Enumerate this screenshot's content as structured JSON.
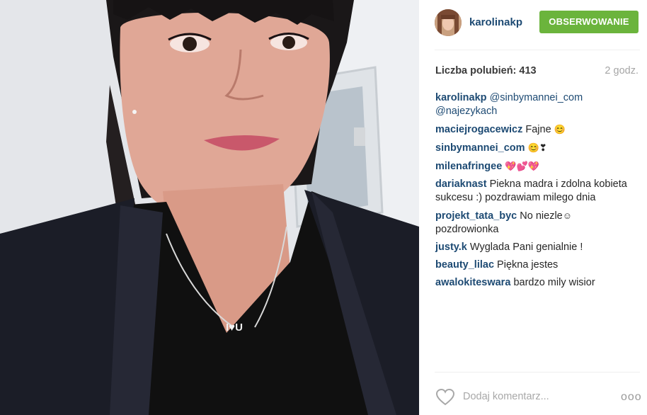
{
  "post": {
    "username": "karolinakp",
    "follow_label": "OBSERWOWANIE",
    "likes_text": "Liczba polubień: 413",
    "time_text": "2 godz.",
    "add_comment_placeholder": "Dodaj komentarz...",
    "more_label": "ooo",
    "colors": {
      "follow_button": "#6bb43c",
      "username": "#1d4a73"
    }
  },
  "comments": [
    {
      "user": "karolinakp",
      "text_parts": [
        "@sinbymannei_com",
        "@najezykach"
      ]
    },
    {
      "user": "maciejrogacewicz",
      "text": "Fajne",
      "emoji": "😊"
    },
    {
      "user": "sinbymannei_com",
      "emoji": "😊❣"
    },
    {
      "user": "milenafringee",
      "emoji": "💖💕💖"
    },
    {
      "user": "dariaknast",
      "text": "Piekna madra i zdolna kobieta sukcesu :) pozdrawiam milego dnia"
    },
    {
      "user": "projekt_tata_byc",
      "text": "No niezle",
      "emoji": "☺",
      "text2": "pozdrowionka"
    },
    {
      "user": "justy.k",
      "text": "Wyglada Pani genialnie !"
    },
    {
      "user": "beauty_lilac",
      "text": "Piękna jestes"
    },
    {
      "user": "awalokiteswara",
      "text": "bardzo mily wisior"
    }
  ],
  "photo": {
    "pendant_text": "I♥U",
    "icons": [
      "heart-icon",
      "more-options-icon"
    ]
  }
}
